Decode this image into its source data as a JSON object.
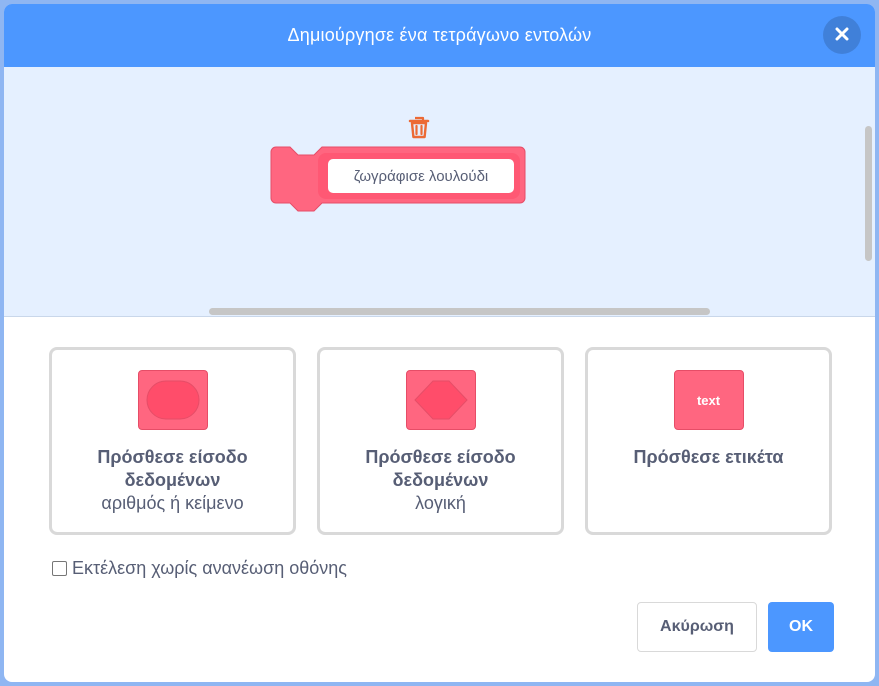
{
  "dialog": {
    "title": "Δημιούργησε ένα τετράγωνο εντολών",
    "close_icon": "close-icon"
  },
  "workspace": {
    "block_label": "ζωγράφισε λουλούδι",
    "block_color": "#ff6680",
    "trash_icon": "trash-icon",
    "trash_color": "#ec6a35"
  },
  "options": [
    {
      "title": "Πρόσθεσε είσοδο δεδομένων",
      "subtitle": "αριθμός ή κείμενο",
      "icon": "round-input-icon"
    },
    {
      "title": "Πρόσθεσε είσοδο δεδομένων",
      "subtitle": "λογική",
      "icon": "hexagon-input-icon"
    },
    {
      "title": "Πρόσθεσε ετικέτα",
      "subtitle": "",
      "icon": "label-icon",
      "icon_text": "text"
    }
  ],
  "run_without_refresh": {
    "label": "Εκτέλεση χωρίς ανανέωση οθόνης",
    "checked": false
  },
  "buttons": {
    "cancel": "Ακύρωση",
    "ok": "OK"
  },
  "colors": {
    "header": "#4c97ff",
    "accent": "#4c97ff",
    "text": "#575e75"
  }
}
